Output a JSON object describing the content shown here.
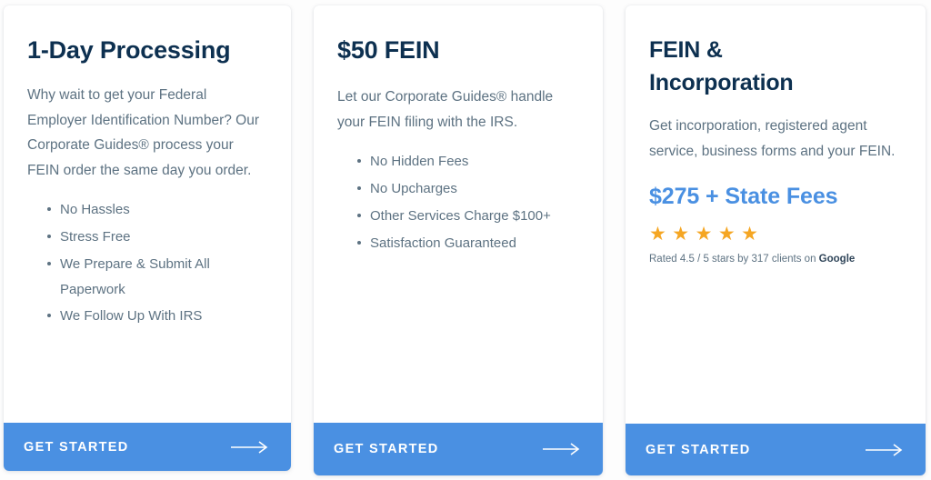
{
  "theme": {
    "title_color": "#0d3050",
    "body_color": "#5d7282",
    "accent_blue": "#4a90e2",
    "star_orange": "#f5a623",
    "card_background": "#ffffff",
    "page_background": "#fdfdfd"
  },
  "cards": [
    {
      "id": "one-day-processing",
      "title": "1-Day Processing",
      "description": "Why wait to get your Federal Employer Identification Number? Our Corporate Guides® process your FEIN order the same day you order.",
      "features": [
        "No Hassles",
        "Stress Free",
        "We Prepare & Submit All Paperwork",
        "We Follow Up With IRS"
      ],
      "cta_label": "GET STARTED",
      "cta_icon": "arrow-right-icon"
    },
    {
      "id": "fifty-dollar-fein",
      "title": "$50 FEIN",
      "description": "Let our Corporate Guides® handle your FEIN filing with the IRS.",
      "features": [
        "No Hidden Fees",
        "No Upcharges",
        "Other Services Charge $100+",
        "Satisfaction Guaranteed"
      ],
      "cta_label": "GET STARTED",
      "cta_icon": "arrow-right-icon"
    },
    {
      "id": "fein-and-incorporation",
      "title": "FEIN & Incorporation",
      "description": "Get incorporation, registered agent service, business forms and your FEIN.",
      "price": "$275 + State Fees",
      "rating": {
        "stars_filled": 5,
        "star_glyph": "★",
        "text_prefix": "Rated 4.5 / 5 stars by 317 clients on ",
        "brand": "Google",
        "score": "4.5",
        "out_of": "5",
        "client_count": "317"
      },
      "cta_label": "GET STARTED",
      "cta_icon": "arrow-right-icon"
    }
  ]
}
